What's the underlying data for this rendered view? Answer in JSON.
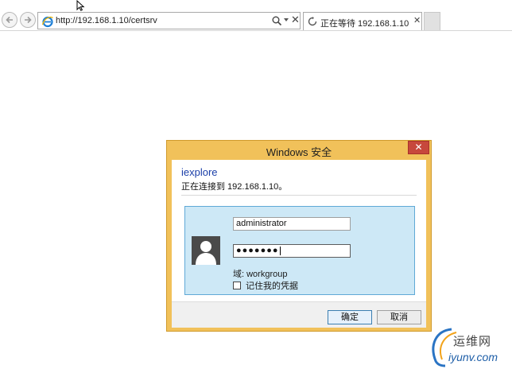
{
  "browser": {
    "address_url": "http://192.168.1.10/certsrv",
    "tab_title": "正在等待 192.168.1.10",
    "tab_close": "✕",
    "addr_stop": "✕"
  },
  "dialog": {
    "title": "Windows 安全",
    "close_label": "✕",
    "app_name": "iexplore",
    "connect_message": "正在连接到 192.168.1.10。",
    "username": "administrator",
    "password_mask": "●●●●●●●",
    "domain_label": "域: workgroup",
    "remember_label": "记住我的凭据",
    "remember_checked": false,
    "ok_label": "确定",
    "cancel_label": "取消"
  },
  "watermark": {
    "cn": "运维网",
    "en": "iyunv.com"
  },
  "colors": {
    "dialog_frame": "#f1c15a",
    "close_button": "#c7483c",
    "credential_panel": "#cde8f6",
    "app_name": "#1a3ea8"
  },
  "icons": [
    "back-icon",
    "forward-icon",
    "ie-logo-icon",
    "search-icon",
    "loading-spinner-icon",
    "user-avatar-icon",
    "mouse-cursor-icon"
  ]
}
